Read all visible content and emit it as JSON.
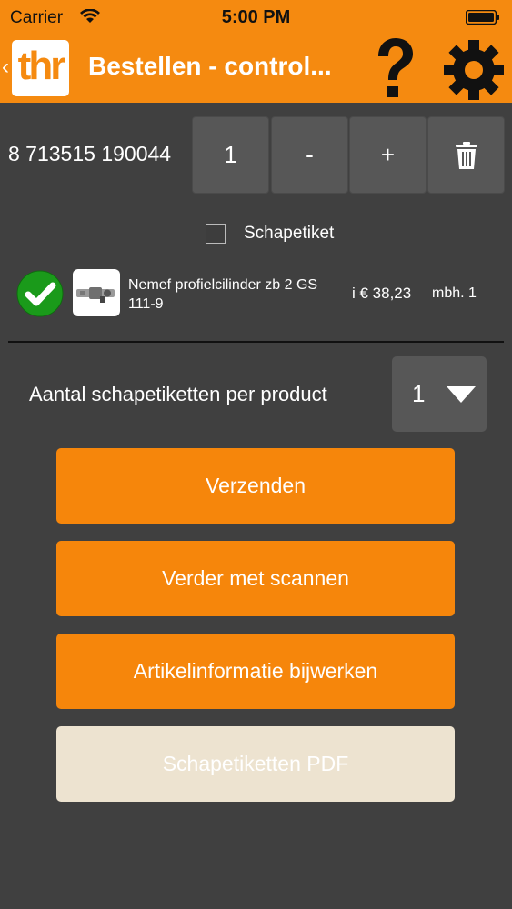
{
  "status_bar": {
    "carrier": "Carrier",
    "time": "5:00 PM"
  },
  "nav": {
    "back_icon": "chevron-left-icon",
    "logo_text": "thr",
    "title": "Bestellen - control...",
    "help_icon": "question-mark-icon",
    "settings_icon": "gear-icon"
  },
  "scan": {
    "barcode": "8 713515 190044",
    "quantity": "1",
    "minus_label": "-",
    "plus_label": "+",
    "delete_icon": "trash-icon"
  },
  "schapetiket": {
    "label": "Schapetiket",
    "checked": false
  },
  "product": {
    "status_icon": "checkmark-circle-icon",
    "name": "Nemef profielcilinder zb 2 GS 111-9",
    "price": "i € 38,23",
    "unit": "mbh. 1"
  },
  "per_product": {
    "label": "Aantal schapetiketten per product",
    "selected": "1"
  },
  "actions": {
    "send": "Verzenden",
    "continue_scanning": "Verder met scannen",
    "update_info": "Artikelinformatie bijwerken",
    "pdf": "Schapetiketten PDF"
  },
  "colors": {
    "accent": "#f58a10",
    "background": "#404040",
    "button_gray": "#575757",
    "disabled": "#ede3d0",
    "success": "#1a9a1a"
  }
}
